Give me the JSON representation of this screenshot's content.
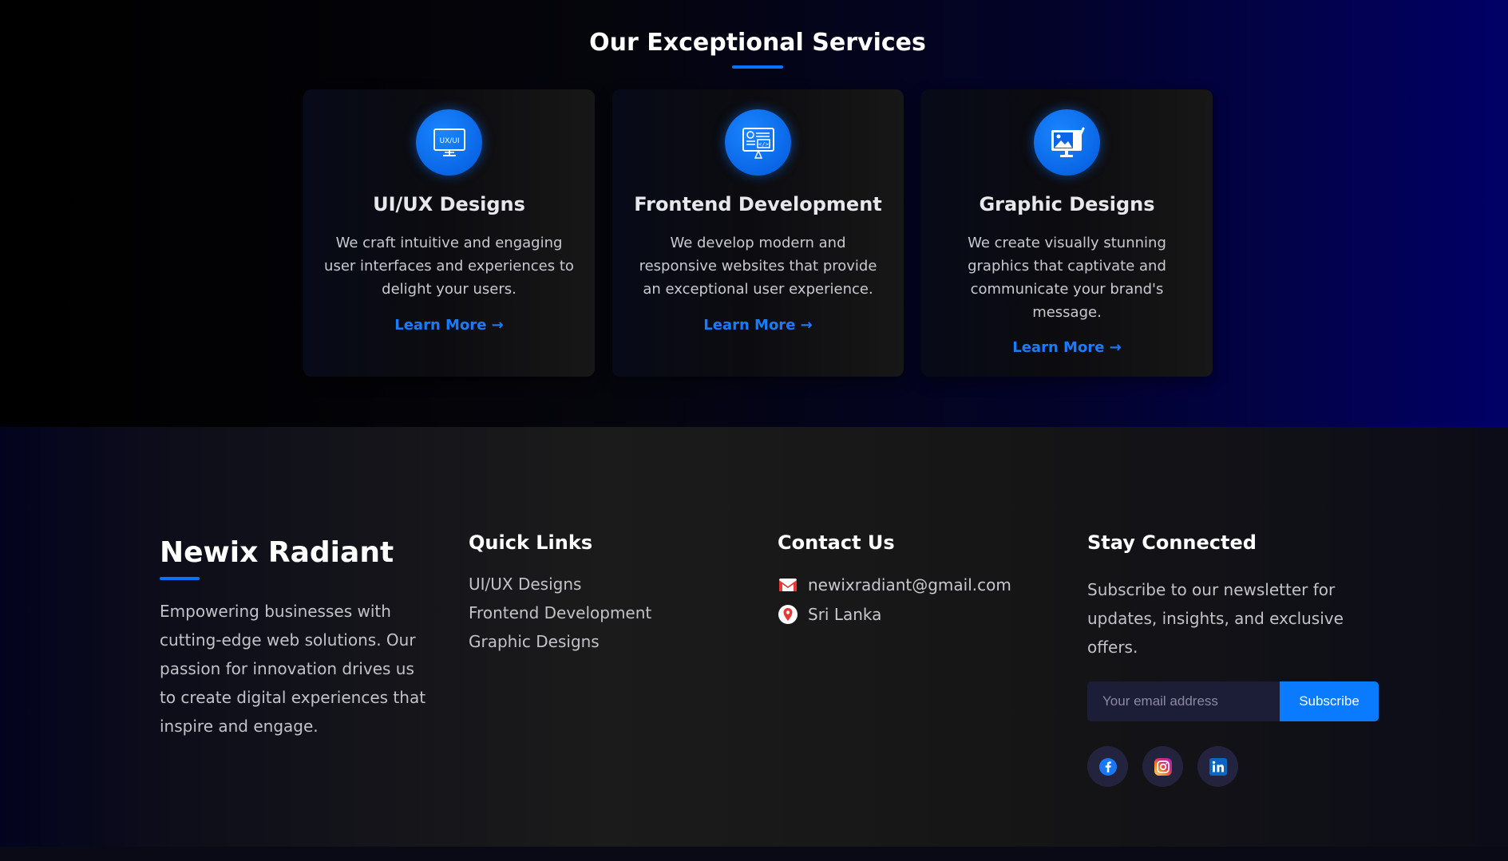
{
  "services": {
    "title": "Our Exceptional Services",
    "cards": [
      {
        "icon": "uiux-monitor-icon",
        "icon_text": "UX/UI",
        "title": "UI/UX Designs",
        "description": "We craft intuitive and engaging user interfaces and experiences to delight your users.",
        "link": "Learn More →"
      },
      {
        "icon": "code-monitor-icon",
        "title": "Frontend Development",
        "description": "We develop modern and responsive websites that provide an exceptional user experience.",
        "link": "Learn More →"
      },
      {
        "icon": "graphic-design-monitor-icon",
        "title": "Graphic Designs",
        "description": "We create visually stunning graphics that captivate and communicate your brand's message.",
        "link": "Learn More →"
      }
    ]
  },
  "footer": {
    "brand": {
      "name": "Newix Radiant",
      "description": "Empowering businesses with cutting-edge web solutions. Our passion for innovation drives us to create digital experiences that inspire and engage."
    },
    "quick_links": {
      "heading": "Quick Links",
      "items": [
        "UI/UX Designs",
        "Frontend Development",
        "Graphic Designs"
      ]
    },
    "contact": {
      "heading": "Contact Us",
      "email": "newixradiant@gmail.com",
      "location": "Sri Lanka",
      "email_icon": "gmail-icon",
      "location_icon": "map-pin-icon"
    },
    "newsletter": {
      "heading": "Stay Connected",
      "text": "Subscribe to our newsletter for updates, insights, and exclusive offers.",
      "placeholder": "Your email address",
      "button": "Subscribe"
    },
    "social": [
      "facebook-icon",
      "instagram-icon",
      "linkedin-icon"
    ]
  },
  "colors": {
    "accent": "#0a7bff",
    "link": "#1a7bff",
    "footer_input_bg": "#1c1d36"
  }
}
